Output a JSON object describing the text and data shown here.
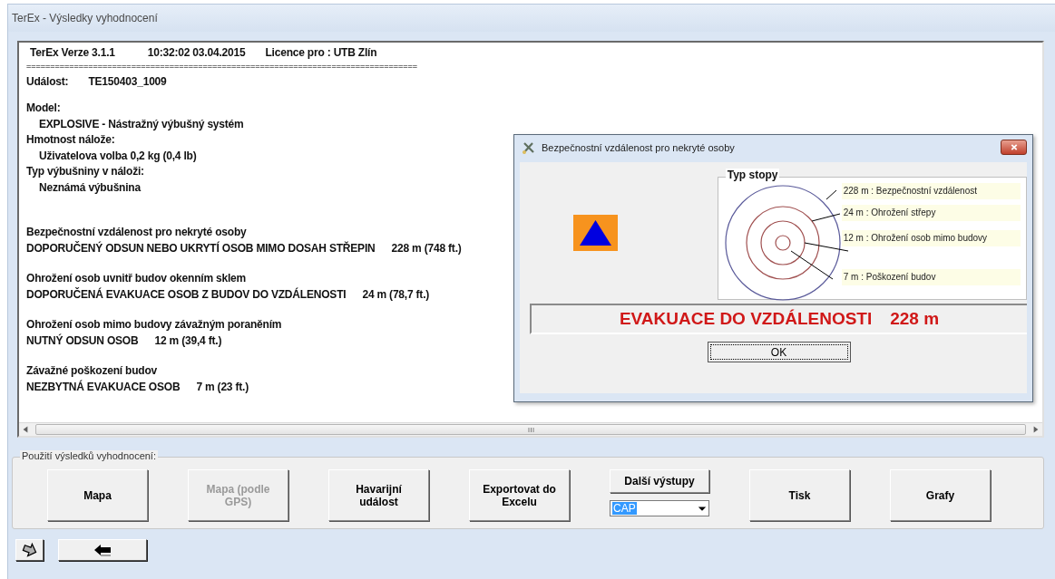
{
  "window": {
    "title": "TerEx - Výsledky vyhodnocení"
  },
  "report": {
    "header": [
      "TerEx  Verze 3.1.1",
      "10:32:02  03.04.2015",
      "Licence pro : UTB Zlín"
    ],
    "rule": "==================================================================================",
    "event": {
      "label": "Událost:",
      "value": "TE150403_1009"
    },
    "blocks": [
      {
        "kind": "info",
        "lines": [
          {
            "kind": "heading",
            "text": "Model:"
          },
          {
            "kind": "indent",
            "text": "EXPLOSIVE - Nástražný výbušný systém"
          },
          {
            "kind": "heading",
            "text": "Hmotnost nálože:"
          },
          {
            "kind": "indent",
            "text": "Uživatelova volba  0,2 kg (0,4 lb)"
          },
          {
            "kind": "heading",
            "text": "Typ výbušniny v náloži:"
          },
          {
            "kind": "indent",
            "text": "Neznámá výbušnina"
          }
        ]
      },
      {
        "kind": "result",
        "lines": [
          {
            "kind": "heading",
            "text": "Bezpečnostní vzdálenost pro nekryté osoby"
          },
          {
            "kind": "value",
            "text": "DOPORUČENÝ ODSUN NEBO UKRYTÍ OSOB MIMO DOSAH STŘEPIN",
            "value": "228 m (748 ft.)"
          }
        ]
      },
      {
        "kind": "result",
        "lines": [
          {
            "kind": "heading",
            "text": "Ohrožení osob uvnitř budov okenním sklem"
          },
          {
            "kind": "value",
            "text": "DOPORUČENÁ EVAKUACE OSOB Z BUDOV DO VZDÁLENOSTI",
            "value": "24 m (78,7 ft.)"
          }
        ]
      },
      {
        "kind": "result",
        "lines": [
          {
            "kind": "heading",
            "text": "Ohrožení osob mimo budovy závažným poraněním"
          },
          {
            "kind": "value",
            "text": "NUTNÝ ODSUN OSOB",
            "value": "12 m (39,4 ft.)"
          }
        ]
      },
      {
        "kind": "result",
        "lines": [
          {
            "kind": "heading",
            "text": "Závažné poškození budov"
          },
          {
            "kind": "value",
            "text": "NEZBYTNÁ EVAKUACE OSOB",
            "value": "7 m (23 ft.)"
          }
        ]
      }
    ]
  },
  "dialog": {
    "title": "Bezpečnostní vzdálenost pro nekryté osoby",
    "legend_title": "Typ stopy",
    "zones": [
      {
        "label": "228 m : Bezpečnostní vzdálenost"
      },
      {
        "label": "24 m : Ohrožení střepy"
      },
      {
        "label": "12 m : Ohrožení osob mimo budovy"
      },
      {
        "label": "7 m : Poškození budov"
      }
    ],
    "banner": {
      "text": "EVAKUACE DO VZDÁLENOSTI",
      "value": "228 m"
    },
    "ok": "OK"
  },
  "usage": {
    "title": "Použití výsledků vyhodnocení:",
    "buttons": [
      {
        "kind": "button",
        "label": "Mapa",
        "disabled": false
      },
      {
        "kind": "button",
        "label": "Mapa (podle GPS)",
        "disabled": true
      },
      {
        "kind": "button",
        "label": "Havarijní událost",
        "disabled": false
      },
      {
        "kind": "button",
        "label": "Exportovat do Excelu",
        "disabled": false
      },
      {
        "kind": "output",
        "label": "Další výstupy",
        "disabled": false,
        "value": "CAP"
      },
      {
        "kind": "button",
        "label": "Tisk",
        "disabled": false
      },
      {
        "kind": "button",
        "label": "Grafy",
        "disabled": false
      }
    ]
  }
}
